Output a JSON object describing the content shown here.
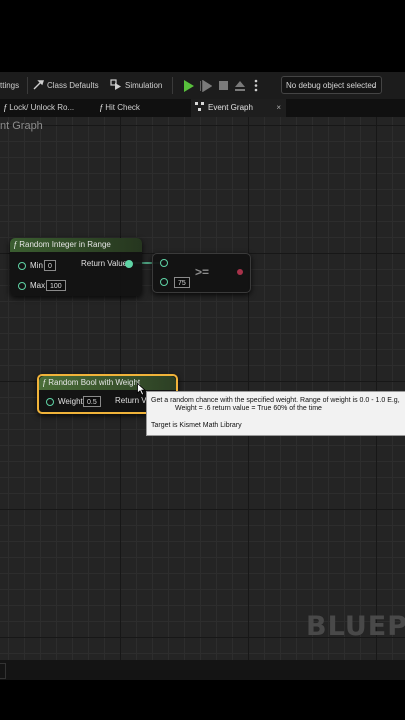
{
  "toolbar": {
    "settings_label": "ttings",
    "class_defaults_label": "Class Defaults",
    "simulation_label": "Simulation",
    "debug_selector": "No debug object selected"
  },
  "tabs": [
    {
      "label": "Lock/ Unlock Ro..."
    },
    {
      "label": "Hit Check"
    },
    {
      "label": "Event Graph",
      "close": "×"
    }
  ],
  "graph": {
    "title": "nt Graph",
    "watermark": "BLUEP"
  },
  "nodes": {
    "random_int": {
      "title": "Random Integer in Range",
      "min_label": "Min",
      "min_value": "0",
      "max_label": "Max",
      "max_value": "100",
      "return_label": "Return Value"
    },
    "compare": {
      "operator": ">=",
      "b_value": "75"
    },
    "random_bool": {
      "title": "Random Bool with Weight",
      "weight_label": "Weight",
      "weight_value": "0.5",
      "return_label": "Return Va"
    }
  },
  "tooltip": {
    "line1": "Get a random chance with the specified weight. Range of weight is 0.0 - 1.0 E.g,",
    "line2": "Weight = .6 return value = True 60% of the time",
    "line3": "Target is Kismet Math Library"
  },
  "colors": {
    "integer_node_header": "#2c4a24",
    "bool_node_header": "#3c5a2c",
    "selection_outline": "#f0b33a",
    "pin_integer": "#5fd3a5",
    "pin_bool": "#a8324a",
    "play_button": "#58c03c"
  },
  "icons": [
    "play-icon",
    "step-icon",
    "stop-icon",
    "eject-icon",
    "more-vertical-icon",
    "function-icon",
    "event-graph-icon",
    "class-defaults-icon",
    "simulation-icon",
    "chevron-down-icon",
    "mouse-cursor-icon"
  ]
}
